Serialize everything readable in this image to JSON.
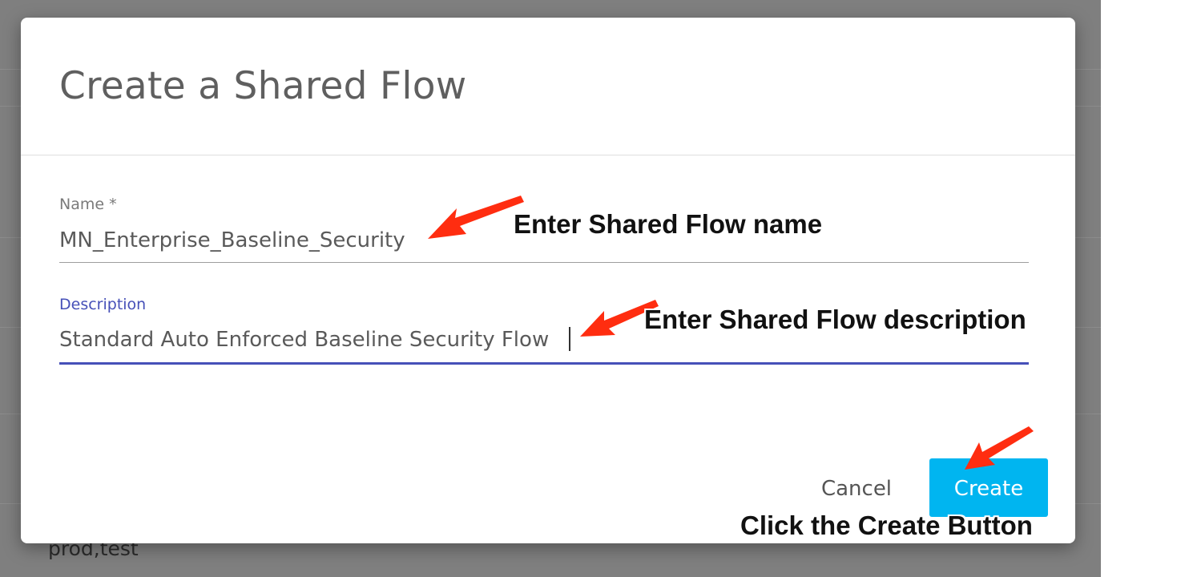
{
  "background": {
    "visible_text": "prod,test"
  },
  "dialog": {
    "title": "Create a Shared Flow",
    "name_field": {
      "label": "Name *",
      "value": "MN_Enterprise_Baseline_Security"
    },
    "description_field": {
      "label": "Description",
      "value": "Standard Auto Enforced Baseline Security Flow"
    },
    "cancel_label": "Cancel",
    "create_label": "Create"
  },
  "annotations": {
    "name_hint": "Enter Shared Flow name",
    "description_hint": "Enter Shared Flow description",
    "create_hint": "Click the Create Button"
  },
  "colors": {
    "accent": "#4650b8",
    "create_button": "#00b5f0",
    "annotation_arrow": "#ff2d10",
    "overlay": "#7f7f7f"
  },
  "icons": {
    "annotation_arrows": "arrow-icon"
  }
}
